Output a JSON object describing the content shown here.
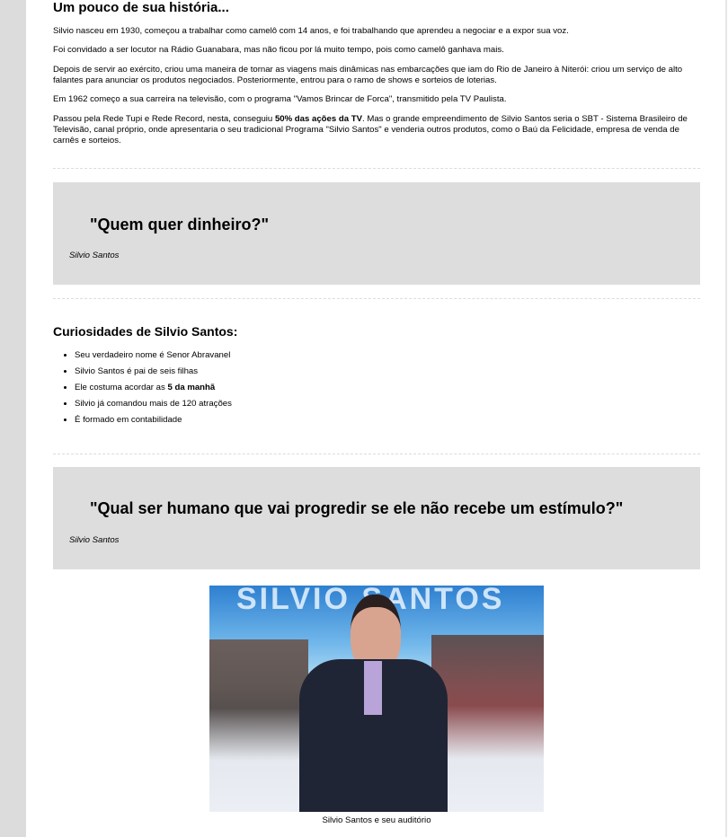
{
  "history": {
    "title": "Um pouco de sua história...",
    "paragraphs": [
      "Silvio nasceu em 1930, começou a trabalhar como camelô com 14 anos, e foi trabalhando que aprendeu a negociar e a expor sua voz.",
      "Foi convidado a ser locutor na Rádio Guanabara, mas não ficou por lá muito tempo, pois como camelô ganhava mais.",
      "Depois de servir ao exército, criou uma maneira de tornar as viagens mais dinâmicas nas embarcações que iam do Rio de Janeiro à Niterói: criou um serviço de alto falantes para anunciar os produtos negociados. Posteriormente, entrou para o ramo de shows e sorteios de loterias.",
      "Em 1962 começo a sua carreira na televisão, com o programa \"Vamos Brincar de Forca\", transmitido pela TV Paulista."
    ],
    "p5_before": "Passou pela Rede Tupi e Rede Record, nesta, conseguiu ",
    "p5_bold": "50% das ações da TV",
    "p5_after": ". Mas o grande empreendimento de Silvio Santos seria o SBT - Sistema Brasileiro de Televisão, canal próprio, onde apresentaria o seu tradicional Programa \"Silvio Santos\" e venderia outros produtos, como o Baú da Felicidade, empresa de venda de carnês e sorteios."
  },
  "quote1": {
    "text": "\"Quem quer dinheiro?\"",
    "author": "Silvio Santos"
  },
  "curiosities": {
    "title": "Curiosidades de Silvio Santos:",
    "items": [
      "Seu verdadeiro nome é Senor Abravanel",
      "Silvio Santos é pai de seis filhas"
    ],
    "item3_before": "Ele costuma acordar as ",
    "item3_bold": "5 da manhã",
    "items_after": [
      "Silvio já comandou mais de 120 atrações",
      "É formado em contabilidade"
    ]
  },
  "quote2": {
    "text": "\"Qual ser humano que vai progredir se ele não recebe um estímulo?\"",
    "author": "Silvio Santos"
  },
  "figure": {
    "sign_text": "SILVIO SANTOS",
    "caption": "Silvio Santos e seu auditório"
  }
}
